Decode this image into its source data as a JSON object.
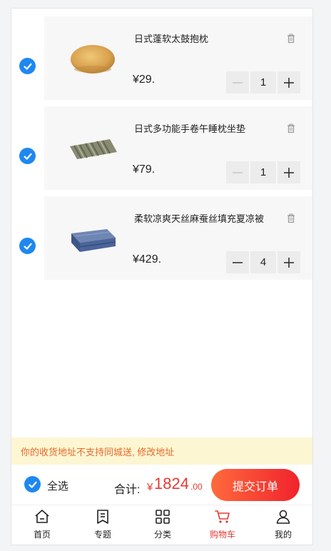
{
  "cart": {
    "items": [
      {
        "name": "日式蓬软太鼓抱枕",
        "price": "¥29.",
        "qty": "1",
        "checked": true,
        "image": "round-cushion"
      },
      {
        "name": "日式多功能手卷午睡枕坐垫",
        "price": "¥79.",
        "qty": "1",
        "checked": true,
        "image": "striped-pillow"
      },
      {
        "name": "柔软凉爽天丝麻蚕丝填充夏凉被",
        "price": "¥429.",
        "qty": "4",
        "checked": true,
        "image": "folded-quilt"
      }
    ]
  },
  "notice": {
    "text": "你的收货地址不支持同城送, 修改地址"
  },
  "checkout": {
    "select_all_label": "全选",
    "total_label": "合计:",
    "currency": "¥",
    "total_int": "1824",
    "total_dec": ".00",
    "submit_label": "提交订单"
  },
  "tabbar": {
    "tabs": [
      {
        "label": "首页",
        "icon": "home-icon",
        "active": false
      },
      {
        "label": "专题",
        "icon": "topic-icon",
        "active": false
      },
      {
        "label": "分类",
        "icon": "category-icon",
        "active": false
      },
      {
        "label": "购物车",
        "icon": "cart-icon",
        "active": true
      },
      {
        "label": "我的",
        "icon": "user-icon",
        "active": false
      }
    ]
  },
  "colors": {
    "accent_blue": "#1e88f0",
    "price_red": "#e53935",
    "notice_bg": "#fcf6d3",
    "notice_text": "#e8692a"
  }
}
